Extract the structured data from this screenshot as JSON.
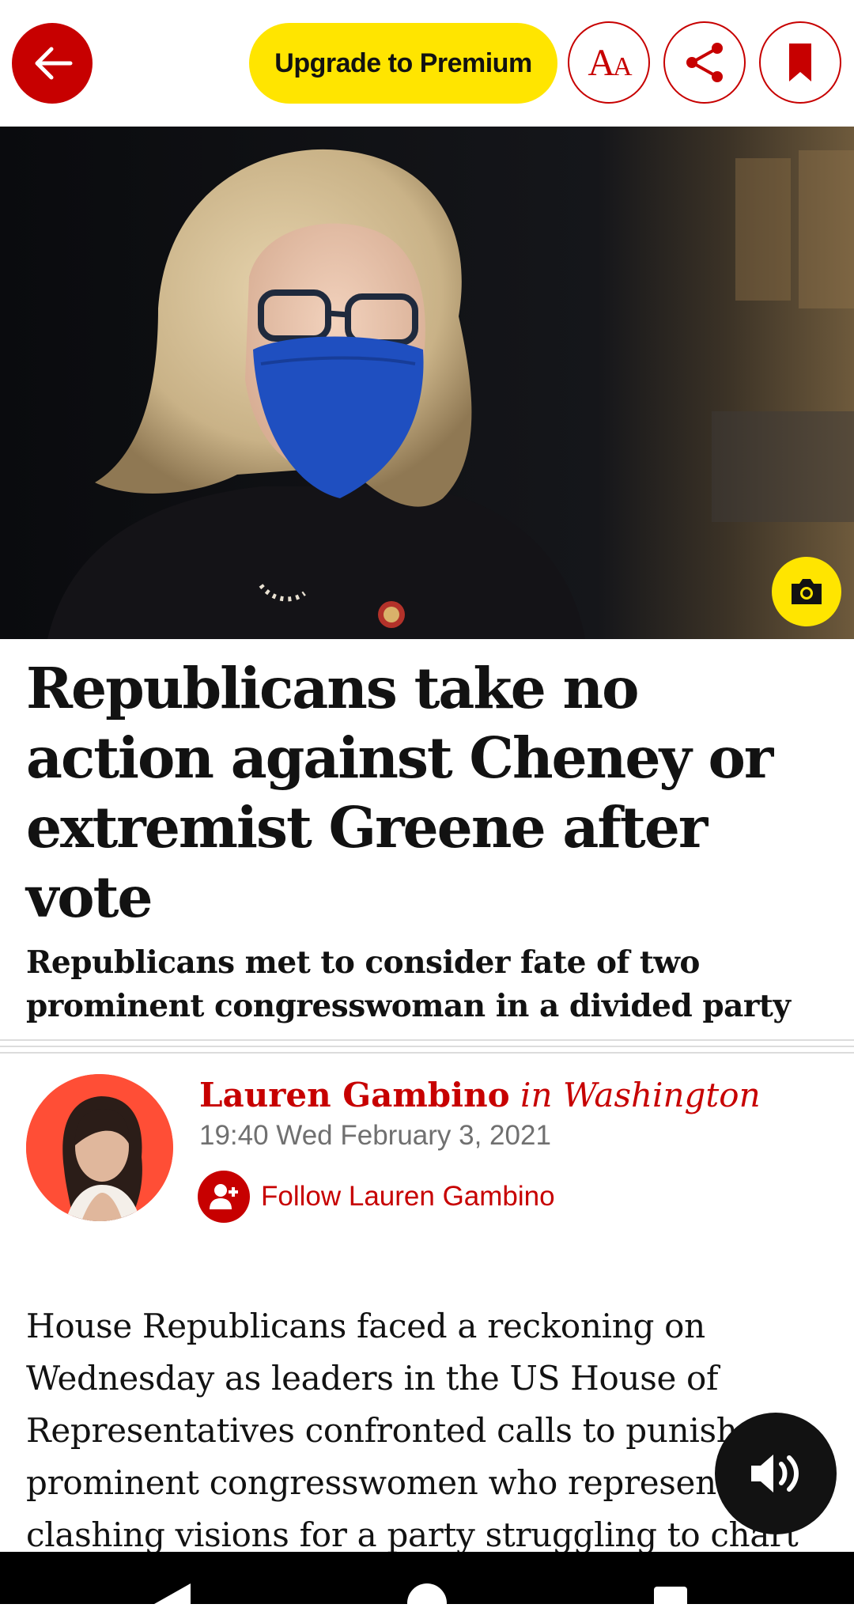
{
  "topbar": {
    "premium_label": "Upgrade to Premium",
    "font_glyph_big": "A",
    "font_glyph_small": "A",
    "icons": [
      "arrow-left-icon",
      "font-size-icon",
      "share-icon",
      "bookmark-icon"
    ]
  },
  "article": {
    "headline": "Republicans take no action against Cheney or extremist Greene after vote",
    "standfirst": "Republicans met to consider fate of two prominent congresswoman in a divided party",
    "author_name": "Lauren Gambino",
    "author_location": "in Washington",
    "dateline": "19:40 Wed February 3, 2021",
    "follow_label": "Follow Lauren Gambino",
    "body_preview": "House Republicans faced a reckoning on Wednesday as leaders in the US House of Representatives confronted calls to punish two prominent congresswomen who represent clashing visions for a party struggling to chart a"
  },
  "colors": {
    "brand_red": "#c70000",
    "premium_yellow": "#ffe500",
    "avatar_bg": "#ff4e36"
  }
}
